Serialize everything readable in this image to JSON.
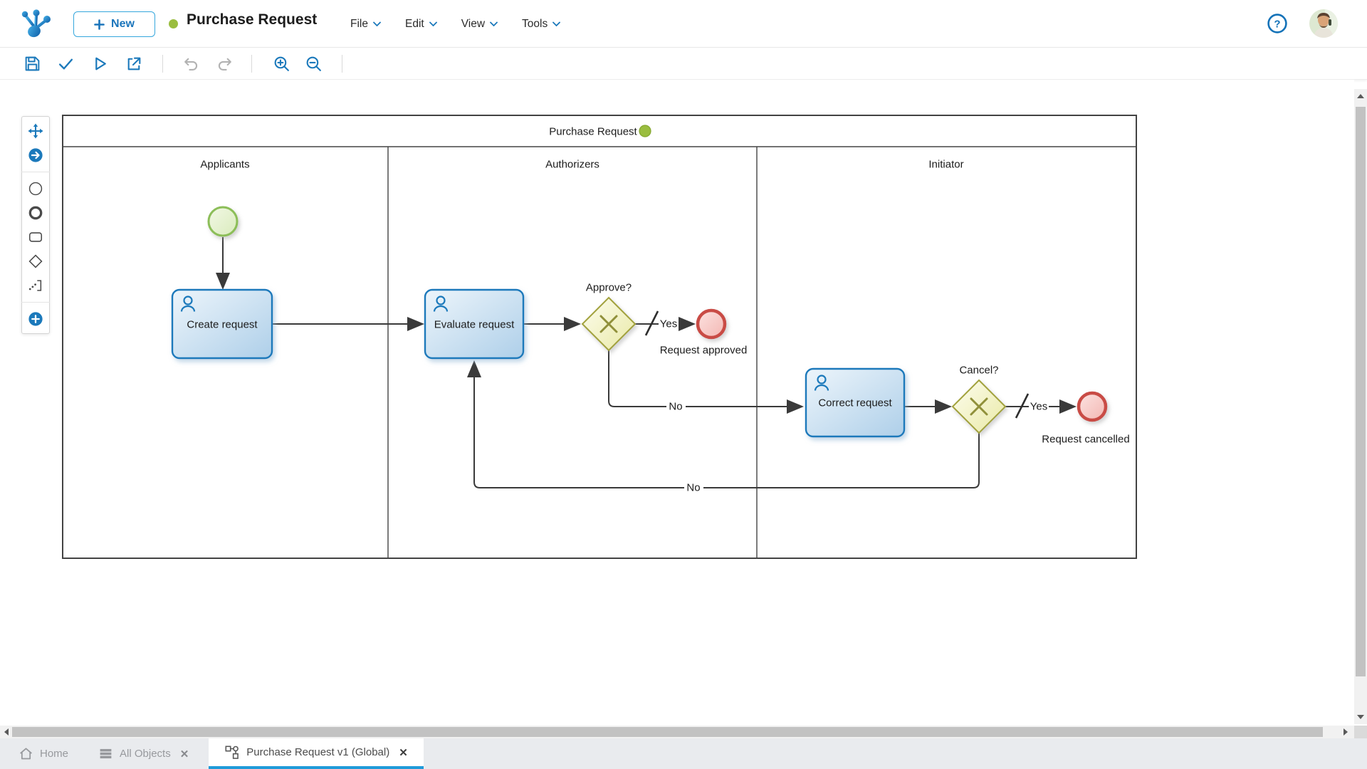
{
  "header": {
    "new_button": "New",
    "title": "Purchase Request",
    "menus": [
      "File",
      "Edit",
      "View",
      "Tools"
    ]
  },
  "glyphs": {
    "help": "?",
    "close": "✕"
  },
  "toolbar": {
    "buttons": [
      "save",
      "validate",
      "run",
      "export",
      "undo",
      "redo",
      "zoom-in",
      "zoom-out"
    ]
  },
  "palette": {
    "tools": [
      "move",
      "sequence-flow",
      "start-event",
      "end-event",
      "task",
      "gateway",
      "annotation",
      "add-element"
    ]
  },
  "diagram": {
    "pool": {
      "title": "Purchase Request"
    },
    "lanes": [
      "Applicants",
      "Authorizers",
      "Initiator"
    ],
    "nodes": [
      {
        "id": "start",
        "type": "start-event",
        "label": "",
        "lane": "Applicants"
      },
      {
        "id": "create",
        "type": "user-task",
        "label": "Create request",
        "lane": "Applicants"
      },
      {
        "id": "evaluate",
        "type": "user-task",
        "label": "Evaluate request",
        "lane": "Authorizers"
      },
      {
        "id": "approve",
        "type": "exclusive-gateway",
        "label": "Approve?",
        "lane": "Authorizers"
      },
      {
        "id": "end1",
        "type": "end-event",
        "label": "Request approved",
        "lane": "Authorizers"
      },
      {
        "id": "correct",
        "type": "user-task",
        "label": "Correct request",
        "lane": "Initiator"
      },
      {
        "id": "cancel",
        "type": "exclusive-gateway",
        "label": "Cancel?",
        "lane": "Initiator"
      },
      {
        "id": "end2",
        "type": "end-event",
        "label": "Request cancelled",
        "lane": "Initiator"
      }
    ],
    "edges": [
      {
        "from": "start",
        "to": "create",
        "label": ""
      },
      {
        "from": "create",
        "to": "evaluate",
        "label": ""
      },
      {
        "from": "evaluate",
        "to": "approve",
        "label": ""
      },
      {
        "from": "approve",
        "to": "end1",
        "label": "Yes",
        "default_flow": true
      },
      {
        "from": "approve",
        "to": "correct",
        "label": "No"
      },
      {
        "from": "correct",
        "to": "cancel",
        "label": ""
      },
      {
        "from": "cancel",
        "to": "end2",
        "label": "Yes",
        "default_flow": true
      },
      {
        "from": "cancel",
        "to": "evaluate",
        "label": "No"
      }
    ]
  },
  "tabs": [
    {
      "label": "Home",
      "closable": false,
      "active": false
    },
    {
      "label": "All Objects",
      "closable": true,
      "active": false
    },
    {
      "label": "Purchase Request v1 (Global)",
      "closable": true,
      "active": true
    }
  ],
  "colors": {
    "brand_blue": "#1b79bb",
    "accent_underline": "#1f9bd9",
    "status_green": "#9abd3f",
    "task_border": "#1b79bb",
    "gateway_border": "#a2a23e",
    "start_border": "#8cbe58",
    "end_border": "#c94b45"
  }
}
